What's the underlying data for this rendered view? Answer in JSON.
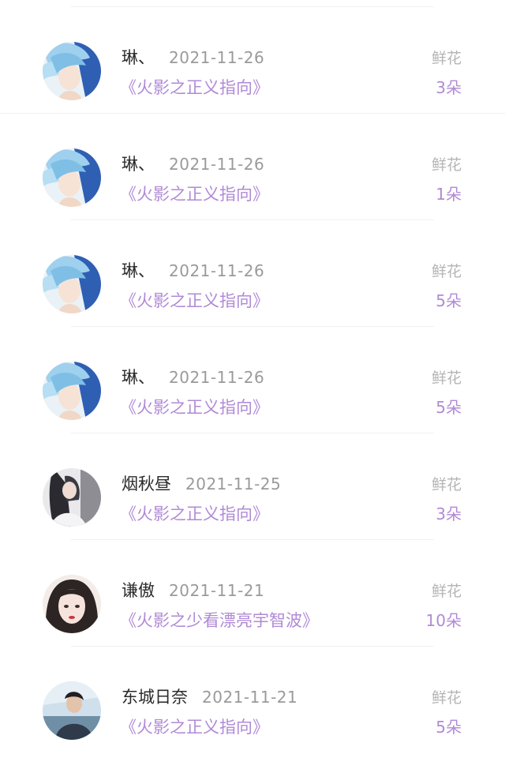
{
  "records": [
    {
      "user": "琳、",
      "date": "2021-11-26",
      "book": "《火影之正义指向》",
      "gift_label": "鲜花",
      "gift_count": "3朵",
      "avatar": "anime-blue-hair-avatar"
    },
    {
      "user": "琳、",
      "date": "2021-11-26",
      "book": "《火影之正义指向》",
      "gift_label": "鲜花",
      "gift_count": "1朵",
      "avatar": "anime-blue-hair-avatar"
    },
    {
      "user": "琳、",
      "date": "2021-11-26",
      "book": "《火影之正义指向》",
      "gift_label": "鲜花",
      "gift_count": "5朵",
      "avatar": "anime-blue-hair-avatar"
    },
    {
      "user": "琳、",
      "date": "2021-11-26",
      "book": "《火影之正义指向》",
      "gift_label": "鲜花",
      "gift_count": "5朵",
      "avatar": "anime-blue-hair-avatar"
    },
    {
      "user": "烟秋昼",
      "date": "2021-11-25",
      "book": "《火影之正义指向》",
      "gift_label": "鲜花",
      "gift_count": "3朵",
      "avatar": "dark-hair-girl-avatar"
    },
    {
      "user": "谦傲",
      "date": "2021-11-21",
      "book": "《火影之少看漂亮宇智波》",
      "gift_label": "鲜花",
      "gift_count": "10朵",
      "avatar": "portrait-girl-avatar"
    },
    {
      "user": "东城日奈",
      "date": "2021-11-21",
      "book": "《火影之正义指向》",
      "gift_label": "鲜花",
      "gift_count": "5朵",
      "avatar": "boy-photo-avatar"
    }
  ],
  "colors": {
    "accent": "#b08ad6",
    "name": "#2b2b2b",
    "date": "#9a9a9a",
    "label": "#b5b5b5",
    "divider": "#f0f0f0"
  }
}
